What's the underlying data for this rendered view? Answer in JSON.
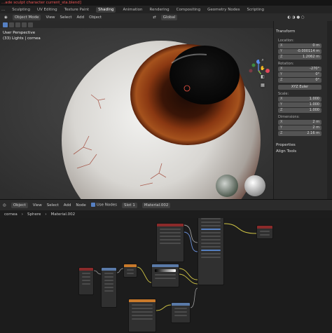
{
  "window": {
    "title": "...ade sculpt character current_sta.blend]"
  },
  "workspace_tabs": [
    "Sculpting",
    "UV Editing",
    "Texture Paint",
    "Shading",
    "Animation",
    "Rendering",
    "Compositing",
    "Geometry Nodes",
    "Scripting"
  ],
  "tabs_prefix": "...",
  "active_tab": "Shading",
  "viewport_header": {
    "mode": "Object Mode",
    "menus": [
      "View",
      "Select",
      "Add",
      "Object"
    ],
    "orientation": "Global"
  },
  "viewport": {
    "perspective_label": "User Perspective",
    "collection_label": "(33) Lights | cornea"
  },
  "npanel": {
    "transform_title": "Transform",
    "location_label": "Location:",
    "location": [
      {
        "axis": "X",
        "value": "0 m"
      },
      {
        "axis": "Y",
        "value": "-0.000114 m"
      },
      {
        "axis": "Z",
        "value": "1.2062 m"
      }
    ],
    "rotation_label": "Rotation:",
    "rotation": [
      {
        "axis": "X",
        "value": "-270°"
      },
      {
        "axis": "Y",
        "value": "0°"
      },
      {
        "axis": "Z",
        "value": "0°"
      }
    ],
    "rotation_mode": "XYZ Euler",
    "scale_label": "Scale:",
    "scale": [
      {
        "axis": "X",
        "value": "1.000"
      },
      {
        "axis": "Y",
        "value": "1.000"
      },
      {
        "axis": "Z",
        "value": "1.000"
      }
    ],
    "dimensions_label": "Dimensions:",
    "dimensions": [
      {
        "axis": "X",
        "value": "2 m"
      },
      {
        "axis": "Y",
        "value": "2 m"
      },
      {
        "axis": "Z",
        "value": "2.16 m"
      }
    ],
    "properties_label": "Properties",
    "align_tools_label": "Align Tools"
  },
  "node_header": {
    "editor_type": "Object",
    "menus": [
      "View",
      "Select",
      "Add",
      "Node"
    ],
    "use_nodes_label": "Use Nodes",
    "slot": "Slot 1",
    "material": "Material.002"
  },
  "breadcrumb": {
    "items": [
      "cornea",
      "Sphere",
      "Material.002"
    ]
  },
  "colors": {
    "accent": "#5680c2",
    "viewport_bg": "#3d3d3d",
    "panel_bg": "#2b2b2b",
    "iris": "#7a2e10",
    "node_header_green": "#2f8a4b",
    "node_header_orange": "#c97a2b",
    "node_header_red": "#8a2a2a",
    "wire_yellow": "#d0c445",
    "wire_gray": "#a0a0a0",
    "wire_blue": "#6a8fd8"
  }
}
